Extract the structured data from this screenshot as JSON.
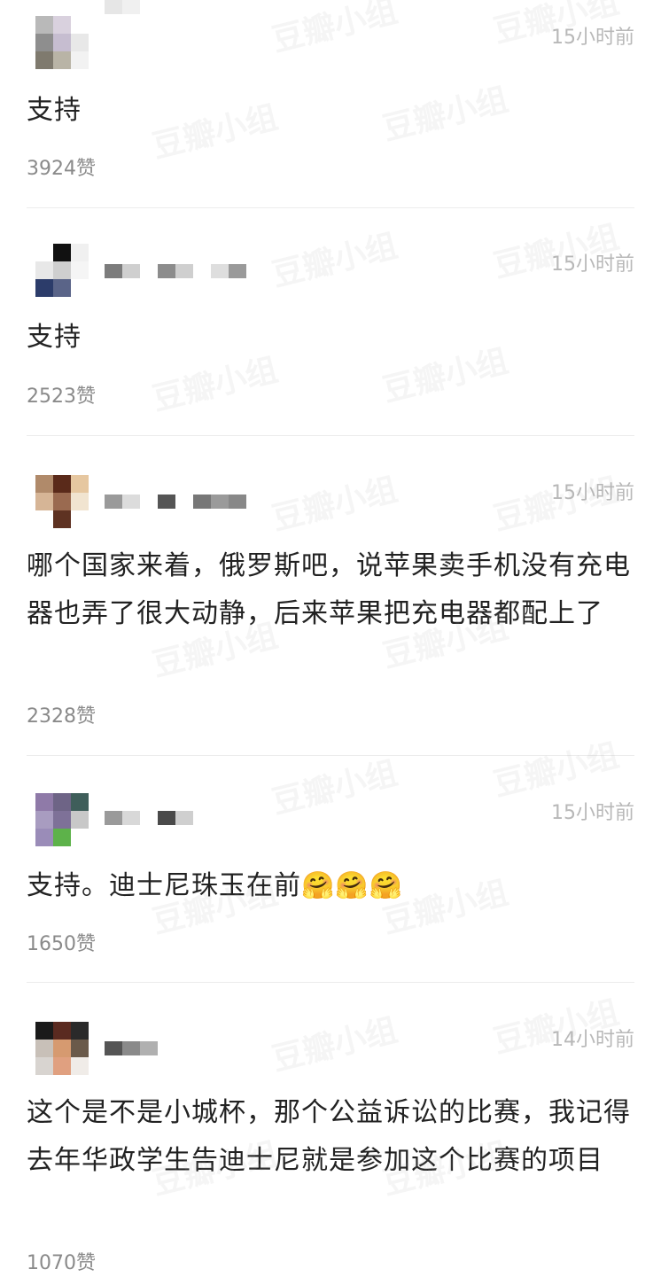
{
  "watermark": "豆瓣小组",
  "comments": [
    {
      "time": "15小时前",
      "text": "支持",
      "likes": "3924赞",
      "avatar": [
        "#b9b9b9",
        "#d9d1de",
        "#ffffff",
        "#8e8e8e",
        "#c6bdd0",
        "#e8e8e8",
        "#7f7a6e",
        "#b9b4a6",
        "#f2f2f2"
      ],
      "name": [
        "#e6e6e6",
        "#f0f0f0"
      ]
    },
    {
      "time": "15小时前",
      "text": "支持",
      "likes": "2523赞",
      "avatar": [
        "#ffffff",
        "#111111",
        "#f0f0f0",
        "#e8e8e8",
        "#cfcfcf",
        "#f5f5f5",
        "#2c3c6a",
        "#5a6488",
        "#ffffff"
      ],
      "name": [
        "#7c7c7c",
        "#cfcfcf",
        "#ffffff",
        "#8c8c8c",
        "#cfcfcf",
        "#ffffff",
        "#dedede",
        "#9a9a9a"
      ]
    },
    {
      "time": "15小时前",
      "text": "哪个国家来着，俄罗斯吧，说苹果卖手机没有充电器也弄了很大动静，后来苹果把充电器都配上了",
      "likes": "2328赞",
      "avatar": [
        "#b08a6a",
        "#5a2a1a",
        "#e6c7a0",
        "#d6b596",
        "#9a6a50",
        "#f1e4d0",
        "#ffffff",
        "#5e3222",
        "#ffffff"
      ],
      "name": [
        "#9a9a9a",
        "#dcdcdc",
        "#ffffff",
        "#555555",
        "#ffffff",
        "#777777",
        "#9a9a9a",
        "#888888"
      ]
    },
    {
      "time": "15小时前",
      "text": "支持。迪士尼珠玉在前",
      "emoji": "🤗🤗🤗",
      "likes": "1650赞",
      "avatar": [
        "#8f7aa8",
        "#6e6486",
        "#3f5e5a",
        "#a89cc0",
        "#7e7198",
        "#c8c8c8",
        "#9a8cb8",
        "#5db24a",
        "#ffffff"
      ],
      "name": [
        "#9a9a9a",
        "#d8d8d8",
        "#ffffff",
        "#4a4a4a",
        "#cfcfcf",
        "#ffffff"
      ]
    },
    {
      "time": "14小时前",
      "text": "这个是不是小城杯，那个公益诉讼的比赛，我记得去年华政学生告迪士尼就是参加这个比赛的项目",
      "likes": "1070赞",
      "avatar": [
        "#1a1a1a",
        "#5a2a20",
        "#2a2a2a",
        "#c8c0b8",
        "#d69a70",
        "#6a5a4a",
        "#d8d4d0",
        "#e0a080",
        "#f0ece8"
      ],
      "name": [
        "#555555",
        "#8a8a8a",
        "#b0b0b0",
        "#ffffff"
      ]
    }
  ]
}
